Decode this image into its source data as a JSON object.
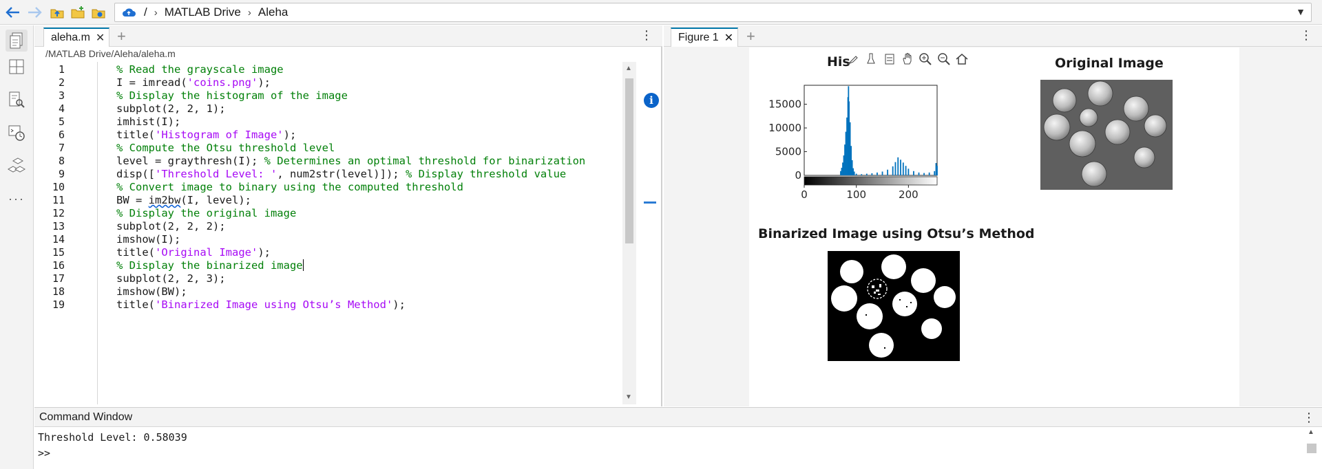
{
  "address_bar": {
    "root": "/",
    "crumbs": [
      "MATLAB Drive",
      "Aleha"
    ]
  },
  "editor": {
    "tab_label": "aleha.m",
    "file_path": "/MATLAB Drive/Aleha/aleha.m",
    "lines": [
      {
        "num": "1",
        "parts": [
          {
            "t": "% Read the grayscale image",
            "c": "cmt"
          }
        ]
      },
      {
        "num": "2",
        "parts": [
          {
            "t": "I = imread(",
            "c": ""
          },
          {
            "t": "'coins.png'",
            "c": "str"
          },
          {
            "t": ");",
            "c": ""
          }
        ]
      },
      {
        "num": "3",
        "parts": [
          {
            "t": "% Display the histogram of the image",
            "c": "cmt"
          }
        ]
      },
      {
        "num": "4",
        "parts": [
          {
            "t": "subplot(2, 2, 1);",
            "c": ""
          }
        ]
      },
      {
        "num": "5",
        "parts": [
          {
            "t": "imhist(I);",
            "c": ""
          }
        ]
      },
      {
        "num": "6",
        "parts": [
          {
            "t": "title(",
            "c": ""
          },
          {
            "t": "'Histogram of Image'",
            "c": "str"
          },
          {
            "t": ");",
            "c": ""
          }
        ]
      },
      {
        "num": "7",
        "parts": [
          {
            "t": "% Compute the Otsu threshold level",
            "c": "cmt"
          }
        ]
      },
      {
        "num": "8",
        "parts": [
          {
            "t": "level = graythresh(I); ",
            "c": ""
          },
          {
            "t": "% Determines an optimal threshold for binarization",
            "c": "cmt"
          }
        ]
      },
      {
        "num": "9",
        "parts": [
          {
            "t": "disp([",
            "c": ""
          },
          {
            "t": "'Threshold Level: '",
            "c": "str"
          },
          {
            "t": ", num2str(level)]); ",
            "c": ""
          },
          {
            "t": "% Display threshold value",
            "c": "cmt"
          }
        ]
      },
      {
        "num": "10",
        "parts": [
          {
            "t": "% Convert image to binary using the computed threshold",
            "c": "cmt"
          }
        ]
      },
      {
        "num": "11",
        "parts": [
          {
            "t": "BW = ",
            "c": ""
          },
          {
            "t": "im2bw",
            "c": "squig"
          },
          {
            "t": "(I, level);",
            "c": ""
          }
        ]
      },
      {
        "num": "12",
        "parts": [
          {
            "t": "% Display the original image",
            "c": "cmt"
          }
        ]
      },
      {
        "num": "13",
        "parts": [
          {
            "t": "subplot(2, 2, 2);",
            "c": ""
          }
        ]
      },
      {
        "num": "14",
        "parts": [
          {
            "t": "imshow(I);",
            "c": ""
          }
        ]
      },
      {
        "num": "15",
        "parts": [
          {
            "t": "title(",
            "c": ""
          },
          {
            "t": "'Original Image'",
            "c": "str"
          },
          {
            "t": ");",
            "c": ""
          }
        ]
      },
      {
        "num": "16",
        "parts": [
          {
            "t": "% Display the binarized image",
            "c": "cmt"
          },
          {
            "t": "",
            "c": "caret"
          }
        ]
      },
      {
        "num": "17",
        "parts": [
          {
            "t": "subplot(2, 2, 3);",
            "c": ""
          }
        ]
      },
      {
        "num": "18",
        "parts": [
          {
            "t": "imshow(BW);",
            "c": ""
          }
        ]
      },
      {
        "num": "19",
        "parts": [
          {
            "t": "title(",
            "c": ""
          },
          {
            "t": "'Binarized Image using Otsu’s Method'",
            "c": "str"
          },
          {
            "t": ");",
            "c": ""
          }
        ]
      }
    ]
  },
  "figure": {
    "tab_label": "Figure 1",
    "titles": {
      "histogram_visible": "His",
      "original": "Original Image",
      "binarized": "Binarized Image using Otsu’s Method"
    }
  },
  "chart_data": {
    "type": "bar",
    "title": "Histogram of Image",
    "xlim": [
      0,
      255
    ],
    "ylim": [
      0,
      19000
    ],
    "x_ticks": [
      0,
      100,
      200
    ],
    "y_ticks": [
      0,
      5000,
      10000,
      15000
    ],
    "bins": [
      [
        70,
        900
      ],
      [
        72,
        1600
      ],
      [
        74,
        2700
      ],
      [
        76,
        4200
      ],
      [
        78,
        6500
      ],
      [
        80,
        9200
      ],
      [
        82,
        12200
      ],
      [
        84,
        16500
      ],
      [
        85,
        18800
      ],
      [
        86,
        15600
      ],
      [
        88,
        11200
      ],
      [
        90,
        6200
      ],
      [
        92,
        3200
      ],
      [
        94,
        1500
      ],
      [
        96,
        800
      ],
      [
        100,
        350
      ],
      [
        110,
        250
      ],
      [
        120,
        350
      ],
      [
        130,
        450
      ],
      [
        140,
        600
      ],
      [
        150,
        800
      ],
      [
        160,
        1200
      ],
      [
        170,
        1900
      ],
      [
        175,
        2800
      ],
      [
        180,
        3800
      ],
      [
        185,
        3300
      ],
      [
        190,
        2700
      ],
      [
        195,
        2000
      ],
      [
        200,
        1400
      ],
      [
        210,
        900
      ],
      [
        220,
        600
      ],
      [
        230,
        500
      ],
      [
        240,
        600
      ],
      [
        250,
        900
      ],
      [
        253,
        2600
      ],
      [
        255,
        2000
      ]
    ]
  },
  "command_window": {
    "title": "Command Window",
    "output": "Threshold Level: 0.58039",
    "prompt": ">>"
  },
  "colors": {
    "accent": "#0076a8",
    "histogram_bar": "#0072bd",
    "comment": "#028009",
    "string": "#a709f5"
  }
}
